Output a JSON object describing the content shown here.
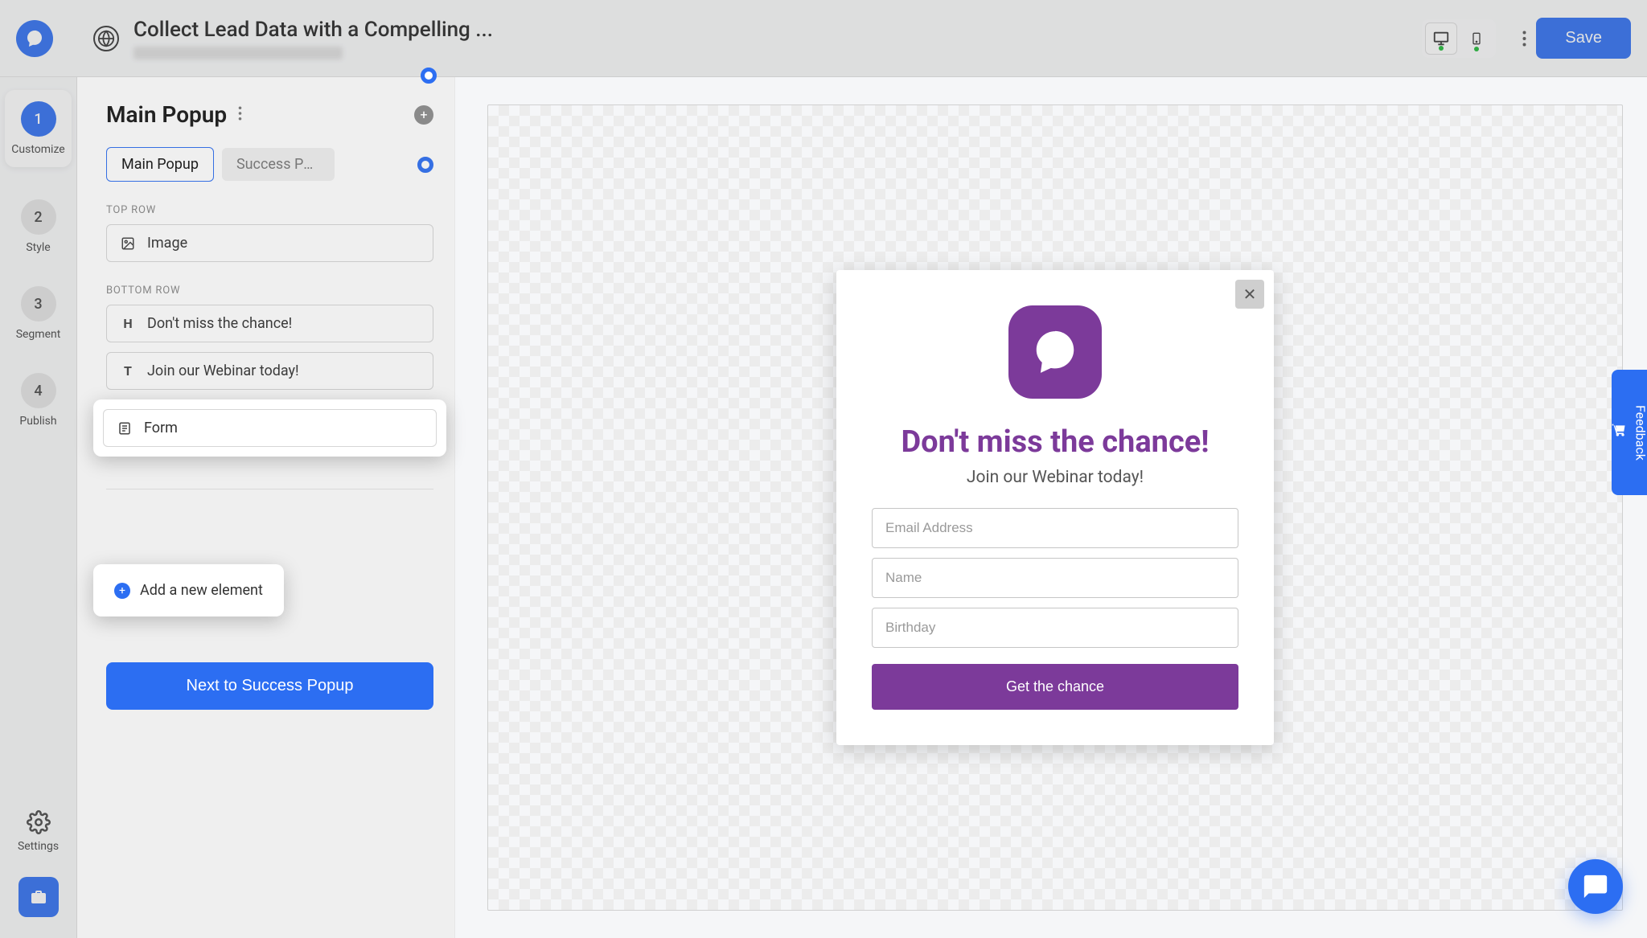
{
  "header": {
    "title": "Collect Lead Data with a Compelling ...",
    "save_label": "Save"
  },
  "sidebar": {
    "steps": [
      {
        "num": "1",
        "label": "Customize"
      },
      {
        "num": "2",
        "label": "Style"
      },
      {
        "num": "3",
        "label": "Segment"
      },
      {
        "num": "4",
        "label": "Publish"
      }
    ],
    "settings_label": "Settings"
  },
  "config": {
    "panel_title": "Main Popup",
    "tabs": {
      "main": "Main Popup",
      "success": "Success Po..."
    },
    "sections": {
      "top": "TOP ROW",
      "bottom": "BOTTOM ROW"
    },
    "rows": {
      "image": "Image",
      "heading": "Don't miss the chance!",
      "text": "Join our Webinar today!",
      "form": "Form"
    },
    "add_element_label": "Add a new element",
    "next_label": "Next to Success Popup"
  },
  "popup": {
    "heading": "Don't miss the chance!",
    "subheading": "Join our Webinar today!",
    "placeholders": {
      "email": "Email Address",
      "name": "Name",
      "birthday": "Birthday"
    },
    "cta": "Get the chance"
  },
  "feedback": {
    "label": "Feedback"
  }
}
